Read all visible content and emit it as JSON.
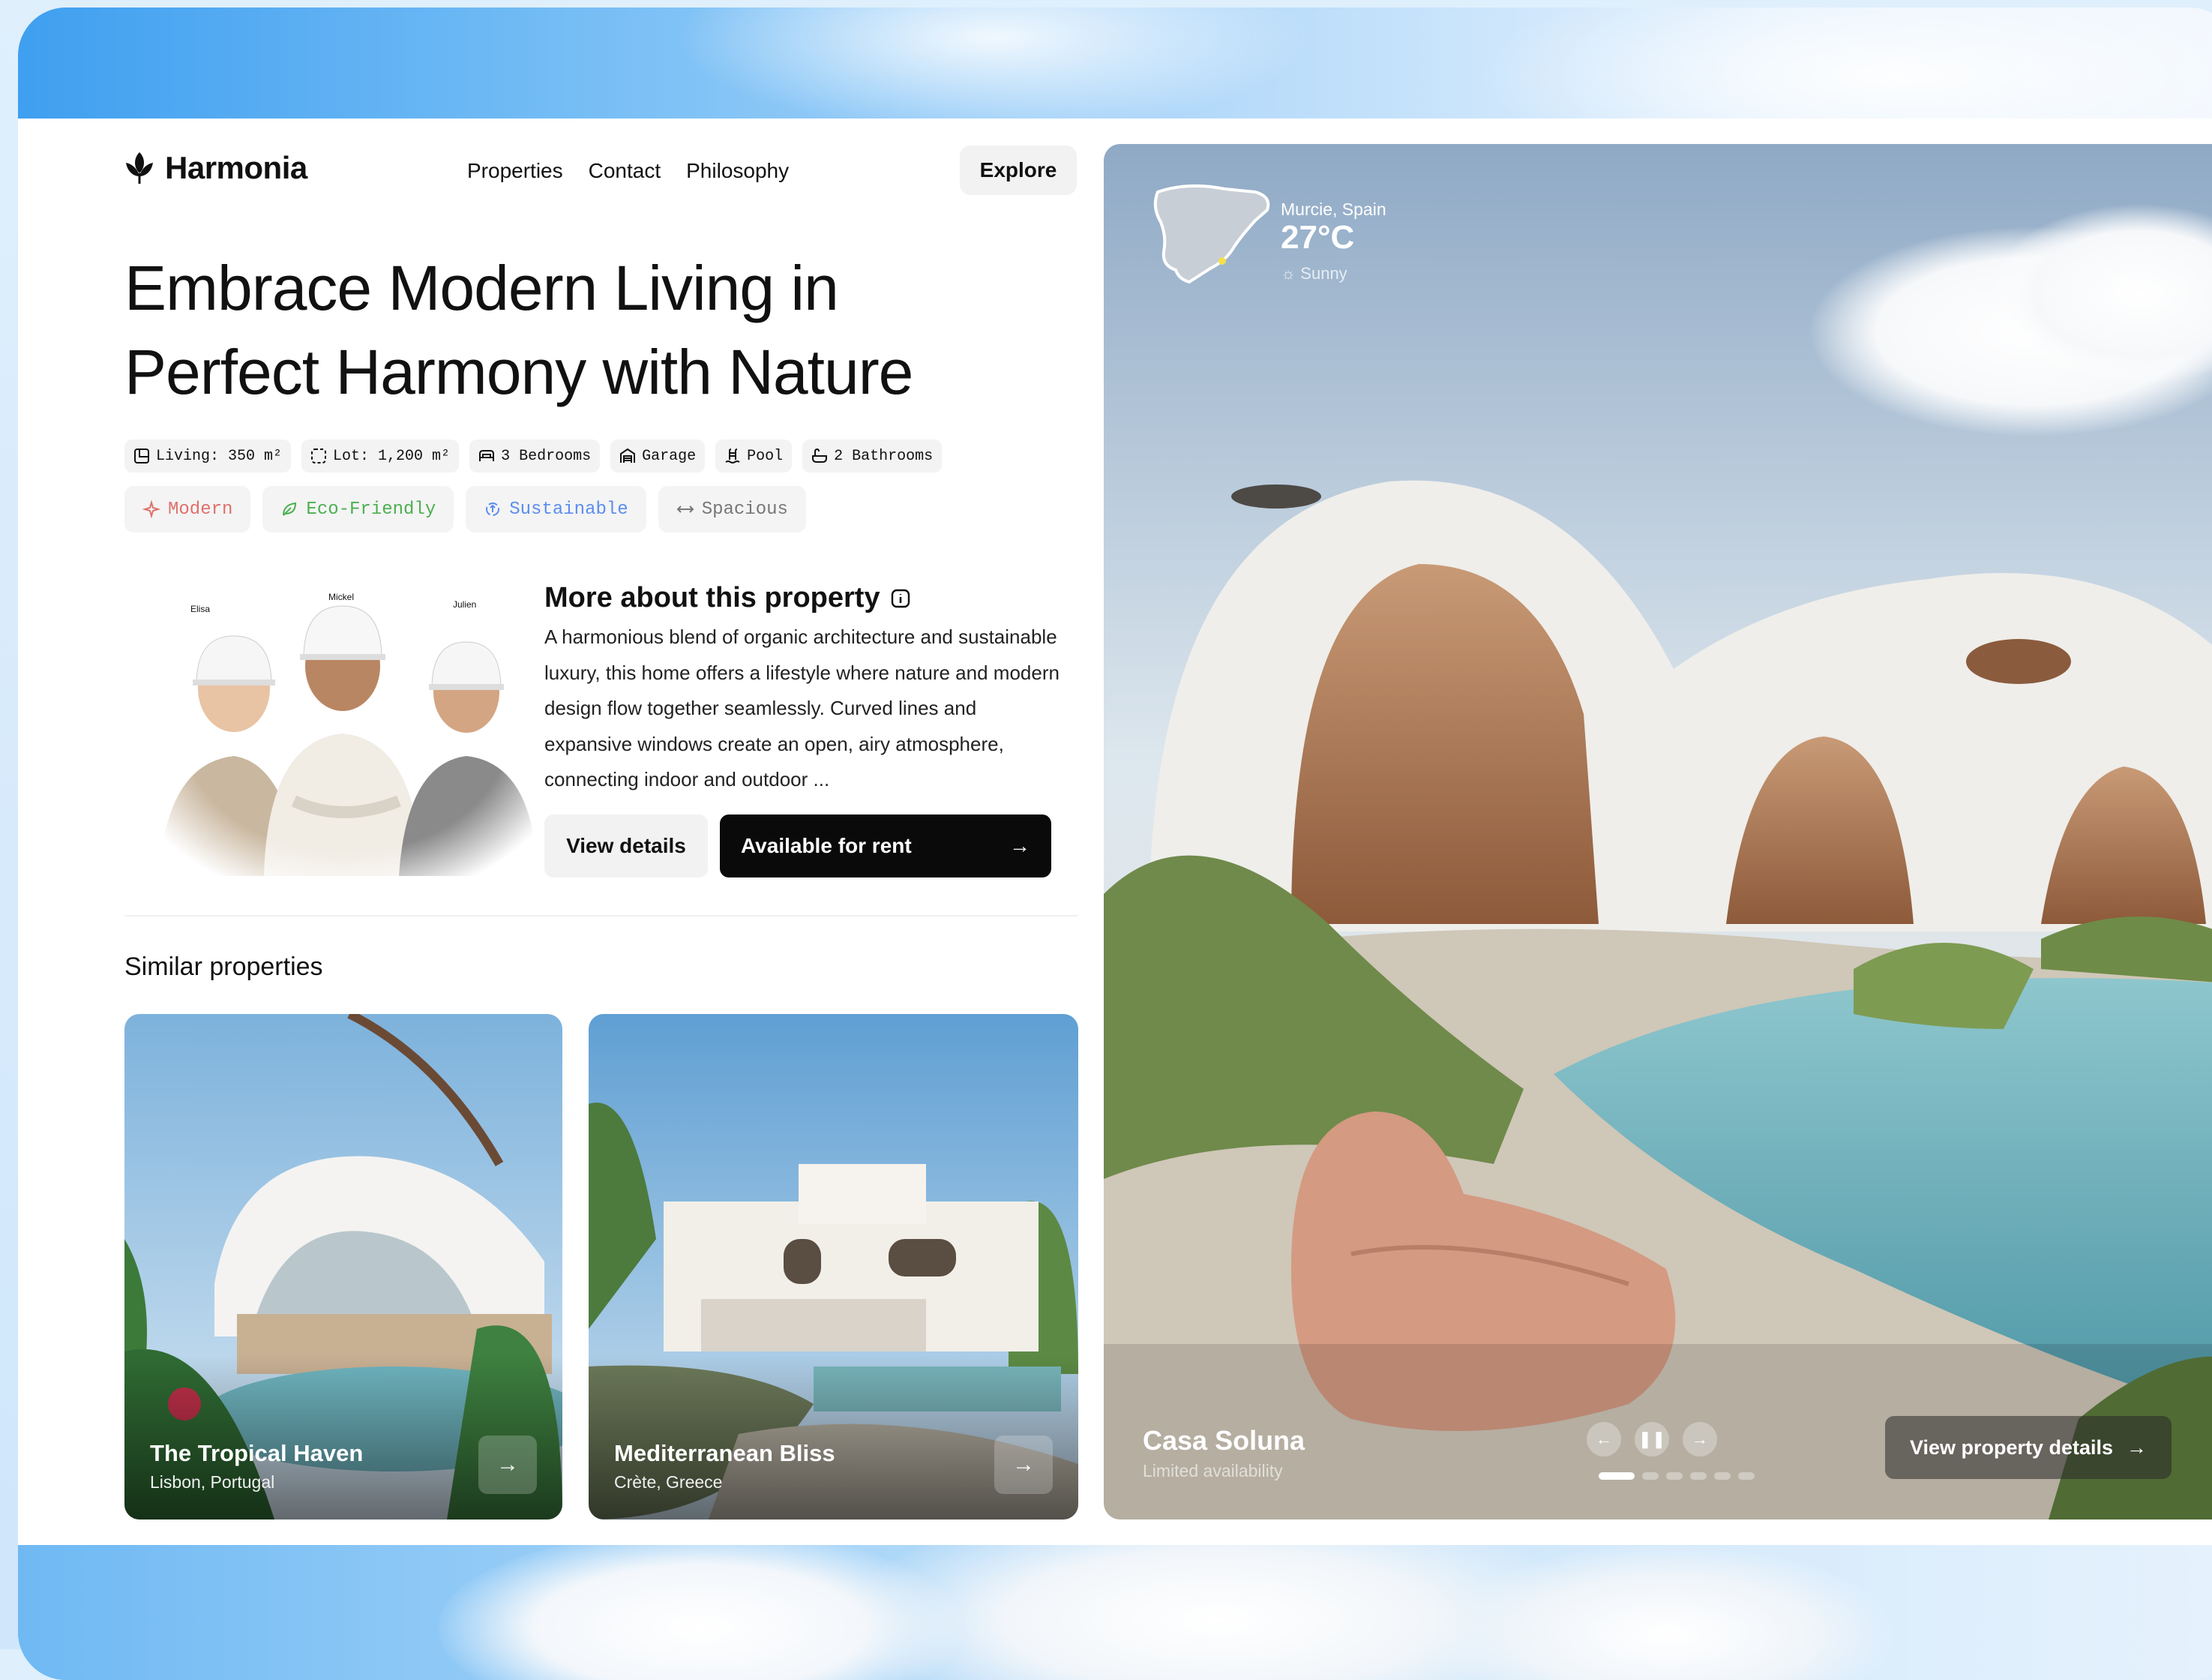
{
  "brand": {
    "name": "Harmonia"
  },
  "nav": {
    "items": [
      "Properties",
      "Contact",
      "Philosophy"
    ],
    "explore": "Explore"
  },
  "hero_title": {
    "line1": "Embrace Modern Living in",
    "line2": "Perfect Harmony with Nature"
  },
  "specs": [
    {
      "icon": "floor-plan-icon",
      "label": "Living: 350 m²"
    },
    {
      "icon": "lot-icon",
      "label": "Lot: 1,200 m²"
    },
    {
      "icon": "bed-icon",
      "label": "3 Bedrooms"
    },
    {
      "icon": "garage-icon",
      "label": "Garage"
    },
    {
      "icon": "pool-icon",
      "label": "Pool"
    },
    {
      "icon": "bath-icon",
      "label": "2 Bathrooms"
    }
  ],
  "tags": [
    {
      "icon": "sparkle-icon",
      "label": "Modern",
      "color": "#e0706b"
    },
    {
      "icon": "leaf-icon",
      "label": "Eco-Friendly",
      "color": "#4caf50"
    },
    {
      "icon": "recycle-icon",
      "label": "Sustainable",
      "color": "#5b8def"
    },
    {
      "icon": "arrows-horizontal-icon",
      "label": "Spacious",
      "color": "#777777"
    }
  ],
  "team": {
    "names": [
      "Elisa",
      "Mickel",
      "Julien"
    ]
  },
  "about": {
    "title": "More about this property",
    "text": "A harmonious blend of organic architecture and sustainable luxury, this home offers a lifestyle where nature and modern design flow together seamlessly. Curved lines and expansive windows create an open, airy atmosphere, connecting indoor and outdoor ...",
    "details_button": "View details",
    "rent_button": "Available for rent"
  },
  "similar": {
    "title": "Similar properties",
    "items": [
      {
        "name": "The Tropical Haven",
        "location": "Lisbon, Portugal"
      },
      {
        "name": "Mediterranean Bliss",
        "location": "Crète, Greece"
      }
    ]
  },
  "weather": {
    "location": "Murcie, Spain",
    "temp": "27°C",
    "condition": "Sunny"
  },
  "featured": {
    "name": "Casa Soluna",
    "availability": "Limited availability",
    "view_button": "View property details",
    "slide_count": 6,
    "active_slide": 1
  },
  "colors": {
    "accent": "#0a0a0a",
    "chip_bg": "#f3f3f3"
  }
}
